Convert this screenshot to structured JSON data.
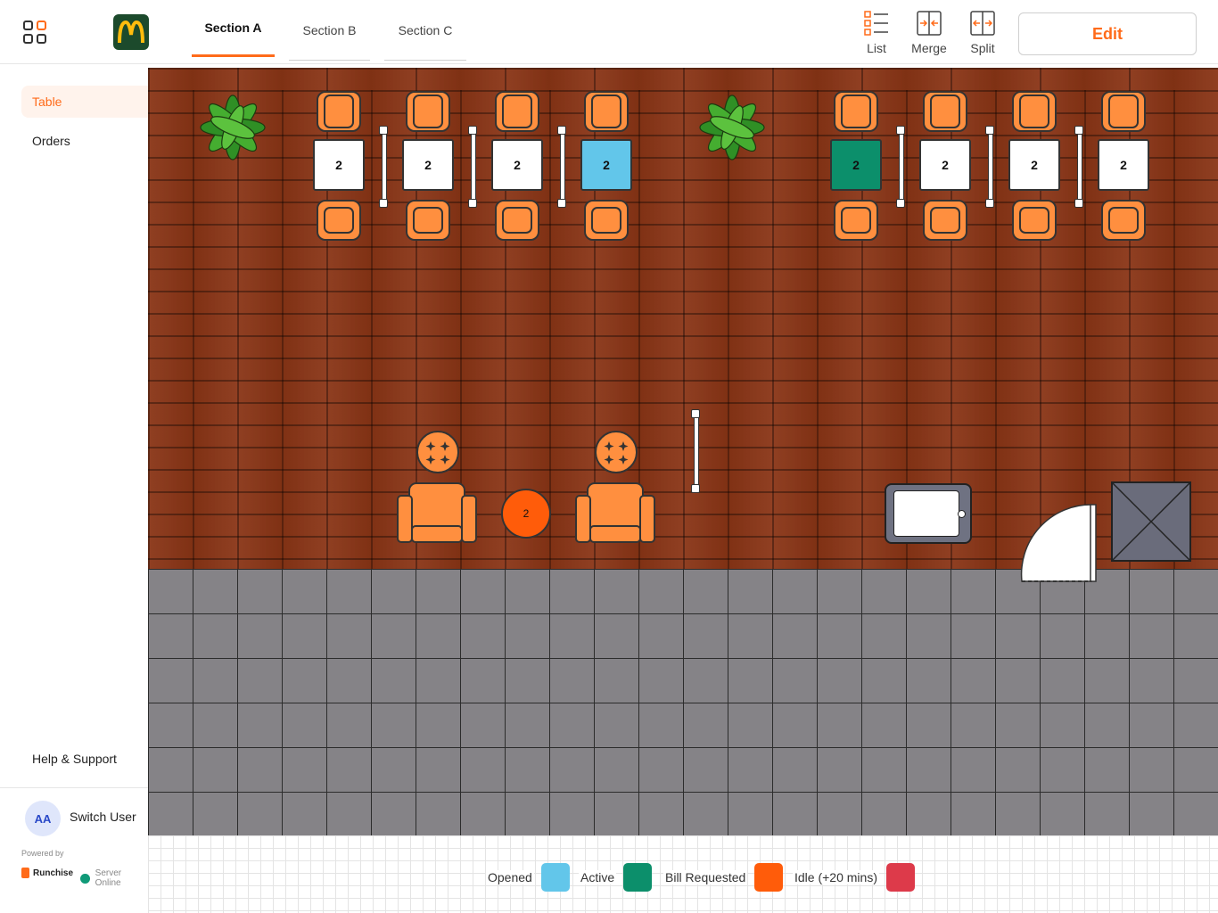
{
  "header": {
    "tabs": [
      {
        "label": "Section A",
        "active": true
      },
      {
        "label": "Section B",
        "active": false
      },
      {
        "label": "Section C",
        "active": false
      }
    ],
    "tools": {
      "list": "List",
      "merge": "Merge",
      "split": "Split"
    },
    "edit_label": "Edit"
  },
  "sidebar": {
    "items": [
      {
        "label": "Table",
        "active": true
      },
      {
        "label": "Orders",
        "active": false
      }
    ],
    "help_label": "Help & Support",
    "user_initials": "AA",
    "switch_user_label": "Switch User",
    "powered_by": "Powered by",
    "brand_name": "Runchise",
    "server_status": "Server Online"
  },
  "floor": {
    "top_tables": [
      {
        "capacity": "2",
        "status": "none"
      },
      {
        "capacity": "2",
        "status": "none"
      },
      {
        "capacity": "2",
        "status": "none"
      },
      {
        "capacity": "2",
        "status": "opened"
      },
      {
        "capacity": "2",
        "status": "active"
      },
      {
        "capacity": "2",
        "status": "none"
      },
      {
        "capacity": "2",
        "status": "none"
      },
      {
        "capacity": "2",
        "status": "none"
      }
    ],
    "round_table": {
      "capacity": "2",
      "status": "bill-requested"
    }
  },
  "legend": [
    {
      "label": "Opened",
      "color": "#62c6ea"
    },
    {
      "label": "Active",
      "color": "#0c8f6b"
    },
    {
      "label": "Bill Requested",
      "color": "#ff5c0a"
    },
    {
      "label": "Idle (+20 mins)",
      "color": "#dd3a4a"
    }
  ],
  "colors": {
    "accent": "#ff6b1a",
    "wood": "#8a3516",
    "tile": "#858387"
  }
}
